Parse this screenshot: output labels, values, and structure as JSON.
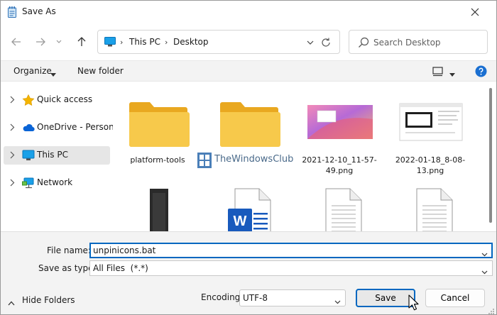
{
  "window": {
    "title": "Save As"
  },
  "nav": {
    "address_segments": [
      "This PC",
      "Desktop"
    ],
    "search_placeholder": "Search Desktop"
  },
  "toolbar": {
    "organize_label": "Organize",
    "new_folder_label": "New folder"
  },
  "sidebar": {
    "items": [
      {
        "label": "Quick access",
        "icon": "star-icon"
      },
      {
        "label": "OneDrive - Personal",
        "icon": "cloud-icon"
      },
      {
        "label": "This PC",
        "icon": "monitor-icon",
        "selected": true
      },
      {
        "label": "Network",
        "icon": "network-icon"
      }
    ]
  },
  "files": [
    {
      "name": "platform-tools",
      "type": "folder"
    },
    {
      "name": "",
      "type": "folder"
    },
    {
      "name": "2021-12-10_11-57-49.png",
      "type": "image"
    },
    {
      "name": "2022-01-18_8-08-13.png",
      "type": "image"
    },
    {
      "name": "",
      "type": "image-dark"
    },
    {
      "name": "",
      "type": "word-document"
    },
    {
      "name": "",
      "type": "text-document"
    },
    {
      "name": "",
      "type": "text-document"
    }
  ],
  "watermark": {
    "text": "TheWindowsClub"
  },
  "form": {
    "file_name_label": "File name:",
    "file_name_value": "unpinicons.bat",
    "save_type_label": "Save as type:",
    "save_type_value": "All Files  (*.*)",
    "encoding_label": "Encoding:",
    "encoding_value": "UTF-8",
    "hide_folders_label": "Hide Folders",
    "save_label": "Save",
    "cancel_label": "Cancel"
  },
  "colors": {
    "accent": "#0067c0",
    "folder": "#f7c94b",
    "word_blue": "#185abd"
  }
}
